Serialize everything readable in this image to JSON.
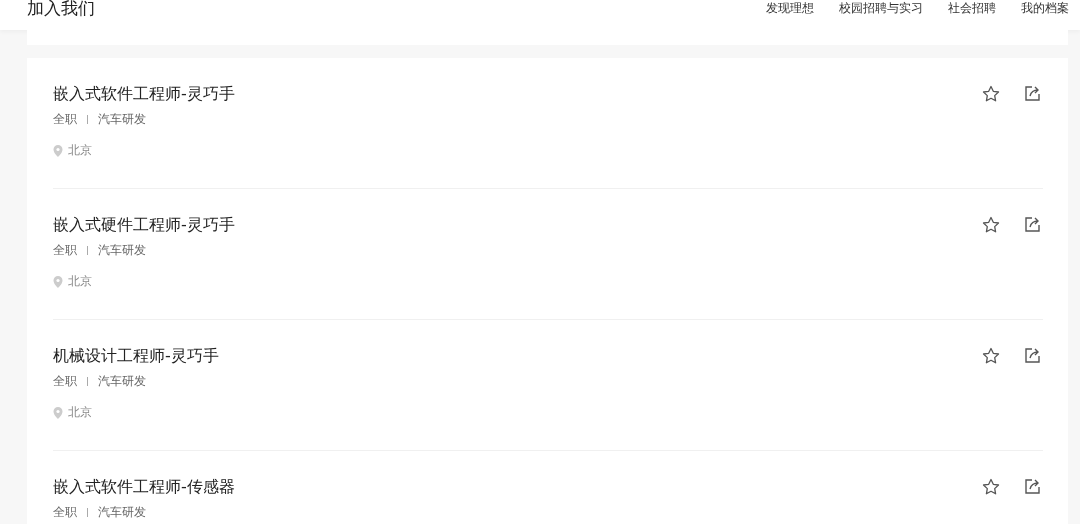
{
  "header": {
    "title": "加入我们",
    "nav": [
      {
        "label": "发现理想"
      },
      {
        "label": "校园招聘与实习"
      },
      {
        "label": "社会招聘"
      },
      {
        "label": "我的档案"
      }
    ]
  },
  "jobs": [
    {
      "title": "嵌入式软件工程师-灵巧手",
      "type": "全职",
      "category": "汽车研发",
      "location": "北京",
      "favorited": false
    },
    {
      "title": "嵌入式硬件工程师-灵巧手",
      "type": "全职",
      "category": "汽车研发",
      "location": "北京",
      "favorited": false
    },
    {
      "title": "机械设计工程师-灵巧手",
      "type": "全职",
      "category": "汽车研发",
      "location": "北京",
      "favorited": false
    },
    {
      "title": "嵌入式软件工程师-传感器",
      "type": "全职",
      "category": "汽车研发",
      "favorited": false
    }
  ]
}
